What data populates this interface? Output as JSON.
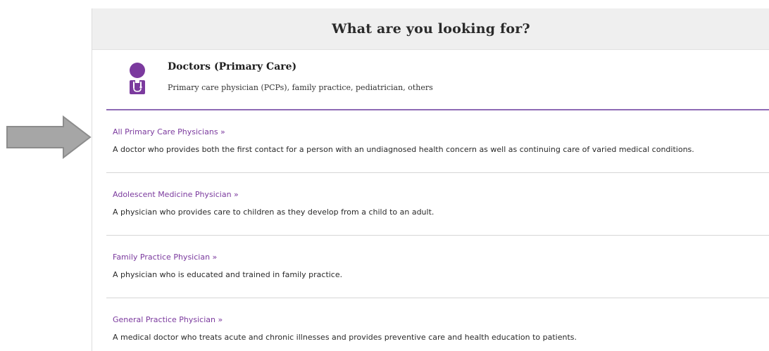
{
  "header": {
    "title": "What are you looking for?"
  },
  "category": {
    "icon": "doctor-icon",
    "title": "Doctors (Primary Care)",
    "subtitle": "Primary care physician (PCPs), family practice, pediatrician, others"
  },
  "items": [
    {
      "label": "All Primary Care Physicians »",
      "description": "A doctor who provides both the first contact for a person with an undiagnosed health concern as well as continuing care of varied medical conditions."
    },
    {
      "label": "Adolescent Medicine Physician »",
      "description": "A physician who provides care to children as they develop from a child to an adult."
    },
    {
      "label": "Family Practice Physician »",
      "description": "A physician who is educated and trained in family practice."
    },
    {
      "label": "General Practice Physician »",
      "description": "A medical doctor who treats acute and chronic illnesses and provides preventive care and health education to patients."
    }
  ],
  "colors": {
    "accent": "#7b3a9e",
    "divider": "#8e6bb5",
    "header_bg": "#efefef",
    "arrow": "#a6a6a6"
  }
}
